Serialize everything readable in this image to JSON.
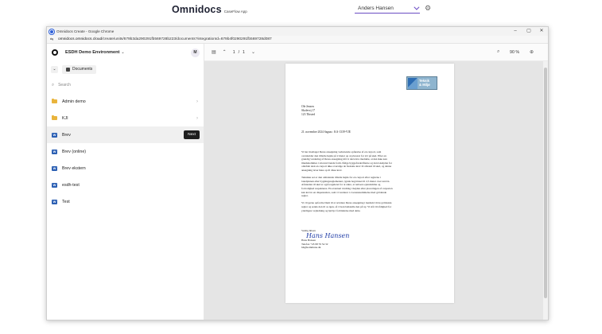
{
  "header": {
    "brand": "Omnidocs",
    "brand_sub": "CaseFlow App",
    "user": "Anders Hansen"
  },
  "browser": {
    "title": "Omnidocs Create - Google Chrome",
    "url_host": "omnidocs.omnidocs.cloud",
    "url_path": "/create/units/679b3da290291fb569728b223/documents?integrationId=679b4f0290291fb569728d087"
  },
  "sidebar": {
    "env_name": "ESDH Demo Environment",
    "avatar": "M",
    "documents_label": "Documents",
    "search_placeholder": "Search",
    "items": [
      {
        "label": "Admin demo",
        "type": "folder"
      },
      {
        "label": "KJI",
        "type": "folder"
      },
      {
        "label": "Brev",
        "type": "doc",
        "active": true
      },
      {
        "label": "Brev (online)",
        "type": "doc"
      },
      {
        "label": "Brev ekstern",
        "type": "doc"
      },
      {
        "label": "esdh-test",
        "type": "doc"
      },
      {
        "label": "Test",
        "type": "doc"
      }
    ],
    "next_label": "Next"
  },
  "viewer": {
    "page_current": "1",
    "page_sep": "/",
    "page_total": "1",
    "zoom": "90 %"
  },
  "letter": {
    "logo_line1": "Teknik",
    "logo_line2": "& Miljø",
    "addr1": "Ole Jensen",
    "addr2": "Skolevej 17",
    "addr3": "123 Thisted",
    "dateline": "21. november 2024    Sagsnr.: KA-1339-VIE",
    "p1": "Vi har modtaget Deres ansøgning vedrørende opførelse af en carport, som overskrider den tilladte højde på 2 meter op at placeret for tæt på skel. Efter en grundig vurdering af Deres ansøgning må vi desværre meddele, at den ikke kan imødekommes i sin nuværende form. Ifølge byggeforskrifterne og den lokalplan for området skal en carport ikke overstige de fastsatte krav til afstand til skel, og denne ansøgning lever ikke op til disse krav.",
    "p2": "Tekniske set er den omtalende tilladte højde for en carport efter reglerne i lokalplanen eller bygningsreglementet, typisk begrænset til 2,5 meter over terræn. Afstanden til skel er også reguleret for at sikre, at naboers ejendomme og fortrolighed respekteres. En eventuel ændring i højden eller placeringen af carporten kan kræve en dispensation, som vi vurderer i overensstemmelse med gældende regler.",
    "p3": "Vi vil gerne opfordre Dem til at revidere Deres ansøgning i henhold til de gældende regler og sende den til os igen, så vi kan behandle den på ny. Vi står til rådighed for yderligere vejledning og hjælp i forbindelse med dette.",
    "closing": "Venlig hilsen",
    "signature": "Hans Hansen",
    "sig_name": "Hans Hansen",
    "sig_phone": "Telefon +45 98 76 54 32",
    "sig_email": "hh@kommune.dk"
  },
  "icons": {
    "gear": "gear-icon",
    "search": "search-icon",
    "folder": "folder-icon",
    "word": "word-doc-icon"
  },
  "colors": {
    "accent": "#6b4dc4",
    "folder": "#e9b43c",
    "word": "#2b5fb3",
    "next_button": "#1f1f1f"
  }
}
